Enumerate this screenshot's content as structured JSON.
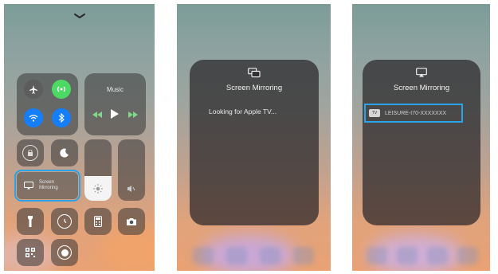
{
  "panel1": {
    "music_label": "Music",
    "screen_mirroring_label_line1": "Screen",
    "screen_mirroring_label_line2": "Mirroring",
    "icons": [
      "chevron-down-icon",
      "airplane-icon",
      "cellular-icon",
      "wifi-icon",
      "bluetooth-icon",
      "rewind-icon",
      "play-icon",
      "fast-forward-icon",
      "rotation-lock-icon",
      "moon-icon",
      "brightness-icon",
      "volume-icon",
      "screen-mirroring-icon",
      "flashlight-icon",
      "timer-icon",
      "calculator-icon",
      "camera-icon",
      "qr-code-icon",
      "screen-record-icon"
    ]
  },
  "panel2": {
    "title": "Screen Mirroring",
    "status": "Looking for Apple TV..."
  },
  "panel3": {
    "title": "Screen Mirroring",
    "device_name": "LEISURE-I70-XXXXXXX",
    "device_badge": "TV"
  },
  "colors": {
    "highlight": "#2aa3e8",
    "toggle_green": "#4cd964",
    "toggle_blue": "#147efb"
  }
}
